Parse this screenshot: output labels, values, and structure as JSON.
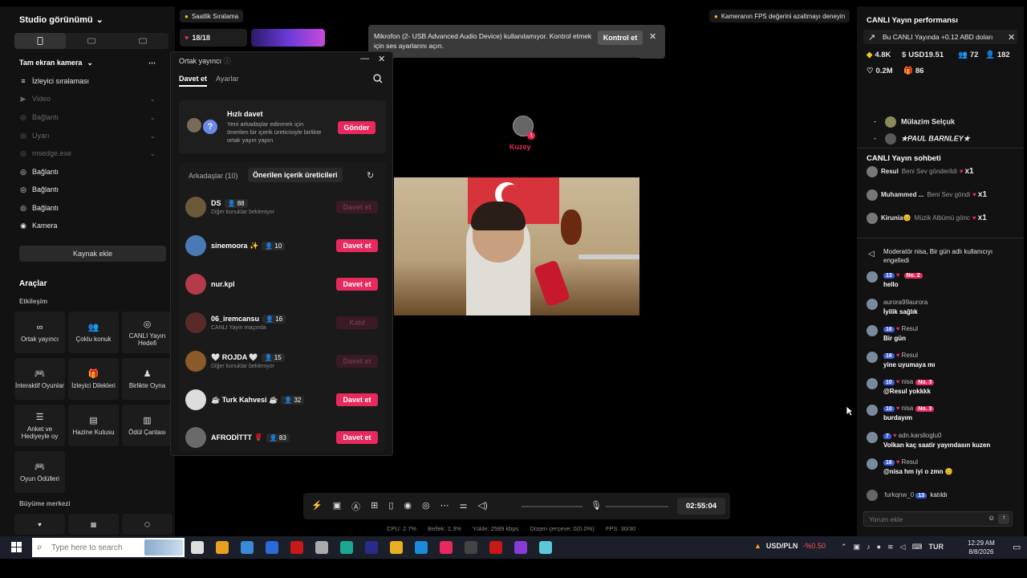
{
  "left": {
    "studio_title": "Studio görünümü",
    "sources_title": "Tam ekran kamera",
    "sources": [
      {
        "label": "İzleyici sıralaması",
        "dim": false
      },
      {
        "label": "Video",
        "dim": true
      },
      {
        "label": "Bağlantı",
        "dim": true
      },
      {
        "label": "Uyarı",
        "dim": true
      },
      {
        "label": "msedge.exe",
        "dim": true
      },
      {
        "label": "Bağlantı",
        "dim": false
      },
      {
        "label": "Bağlantı",
        "dim": false
      },
      {
        "label": "Bağlantı",
        "dim": false
      },
      {
        "label": "Kamera",
        "dim": false
      }
    ],
    "add_source": "Kaynak ekle",
    "tools_title": "Araçlar",
    "interaction_title": "Etkileşim",
    "tools": [
      "Ortak yayıncı",
      "Çoklu konuk",
      "CANLI Yayın Hedefi",
      "İnteraktif Oyunlar",
      "İzleyici Dilekleri",
      "Birlikte Oyna",
      "Anket ve Hediyeyle oy",
      "Hazine Kutusu",
      "Ödül Çantası",
      "Oyun Ödülleri"
    ],
    "growth_title": "Büyüme merkezi"
  },
  "top": {
    "ranking": "Saatlik Sıralama",
    "count": "18/18",
    "mic_warning": "Mikrofon (2- USB Advanced Audio Device) kullanılamıyor. Kontrol etmek için ses ayarlarını açın.",
    "check_btn": "Kontrol et",
    "fps_tip": "Kameranın FPS değerini azaltmayı deneyin"
  },
  "panel": {
    "title": "Ortak yayıncı",
    "tab_invite": "Davet et",
    "tab_settings": "Ayarlar",
    "quick_title": "Hızlı davet",
    "quick_desc": "Yeni arkadaşlar edinmek için önerilen bir içerik üreticisiyle birlikte ortak yayın yapın",
    "send": "Gönder",
    "friends_tab": "Arkadaşlar (10)",
    "suggested_tab": "Önerilen içerik üreticileri",
    "users": [
      {
        "name": "DS",
        "count": "88",
        "sub": "Diğer konuklar bekleniyor",
        "btn": "Davet et",
        "active": false,
        "color": "#6b5a3a"
      },
      {
        "name": "sinemoora ✨",
        "count": "10",
        "sub": "",
        "btn": "Davet et",
        "active": true,
        "color": "#4a7ab5"
      },
      {
        "name": "nur.kpl",
        "count": "",
        "sub": "",
        "btn": "Davet et",
        "active": true,
        "color": "#b53a4a"
      },
      {
        "name": "06_iremcansu",
        "count": "16",
        "sub": "CANLI Yayın maçında",
        "btn": "Katıl",
        "active": false,
        "color": "#5a2a2a"
      },
      {
        "name": "🤍 ROJDA 🤍",
        "count": "15",
        "sub": "Diğer konuklar bekleniyor",
        "btn": "Davet et",
        "active": false,
        "color": "#8a5a2a"
      },
      {
        "name": "☕ Turk Kahvesi ☕",
        "count": "32",
        "sub": "",
        "btn": "Davet et",
        "active": true,
        "color": "#ddd"
      },
      {
        "name": "AFRODİTTT 🌹",
        "count": "83",
        "sub": "",
        "btn": "Davet et",
        "active": true,
        "color": "#6a6a6a"
      }
    ]
  },
  "video": {
    "watermark": "Ⓞ",
    "guest_name": "Kuzey",
    "guest_count": "1"
  },
  "controls": {
    "timer": "02:55:04",
    "stats": [
      "CPU: 2.7%",
      "Bellek: 2.3%",
      "Yükle: 2589 kbps",
      "Düşen çerçeve: 0(0.0%)",
      "FPS: 30/30"
    ]
  },
  "right": {
    "perf_title": "CANLI Yayın performansı",
    "earn_note": "Bu CANLI Yayında +0.12 ABD doları",
    "stats": [
      {
        "icon": "coin-icon",
        "value": "4.8K"
      },
      {
        "icon": "dollar-icon",
        "value": "USD19.51"
      },
      {
        "icon": "viewers-icon",
        "value": "72"
      },
      {
        "icon": "follow-icon",
        "value": "182"
      },
      {
        "icon": "heart-icon",
        "value": "0.2M"
      },
      {
        "icon": "gift-icon",
        "value": "86"
      }
    ],
    "top_users": [
      "Mülazim Selçuk",
      "★PAUL BARNLEY★"
    ],
    "chat_title": "CANLI Yayın sohbeti",
    "gifts": [
      {
        "name": "Resul",
        "text": "Beni Sev gönderildi",
        "mult": "x1"
      },
      {
        "name": "Muhammed ...",
        "text": "Beni Sev göndi",
        "mult": "x1"
      },
      {
        "name": "Kirunia😊",
        "text": "Müzik Albümü gönc",
        "mult": "x1"
      }
    ],
    "mod_notice": "Moderatör nisa, Bir gün adlı kullanıcıyı engelledi",
    "messages": [
      {
        "badge": "13",
        "extra": "No. 2",
        "user": "",
        "text": "hello"
      },
      {
        "badge": "",
        "extra": "",
        "user": "aurora99aurora",
        "text": "İyilik sağlık"
      },
      {
        "badge": "16",
        "extra": "",
        "user": "Resul",
        "text": "Bir gün"
      },
      {
        "badge": "16",
        "extra": "",
        "user": "Resul",
        "text": "yine uyumaya mı"
      },
      {
        "badge": "10",
        "extra": "No. 3",
        "user": "nisa",
        "text": "@Resul yokkkk"
      },
      {
        "badge": "10",
        "extra": "No. 3",
        "user": "nisa",
        "text": "burdayım"
      },
      {
        "badge": "7",
        "extra": "",
        "user": "adn.karslioglu0",
        "text": "Volkan kaç saatir yayındasın kuzen"
      },
      {
        "badge": "16",
        "extra": "",
        "user": "Resul",
        "text": "@nisa hm iyi o zmn 😊"
      }
    ],
    "join_user": "furkqnw_0",
    "join_badge": "13",
    "join_text": "katıldı",
    "comment_placeholder": "Yorum ekle"
  },
  "taskbar": {
    "search_placeholder": "Type here to search",
    "currency": "USD/PLN",
    "currency_change": "-%0.50",
    "lang": "TUR",
    "time": "12:29 AM",
    "date": "8/8/2026"
  }
}
